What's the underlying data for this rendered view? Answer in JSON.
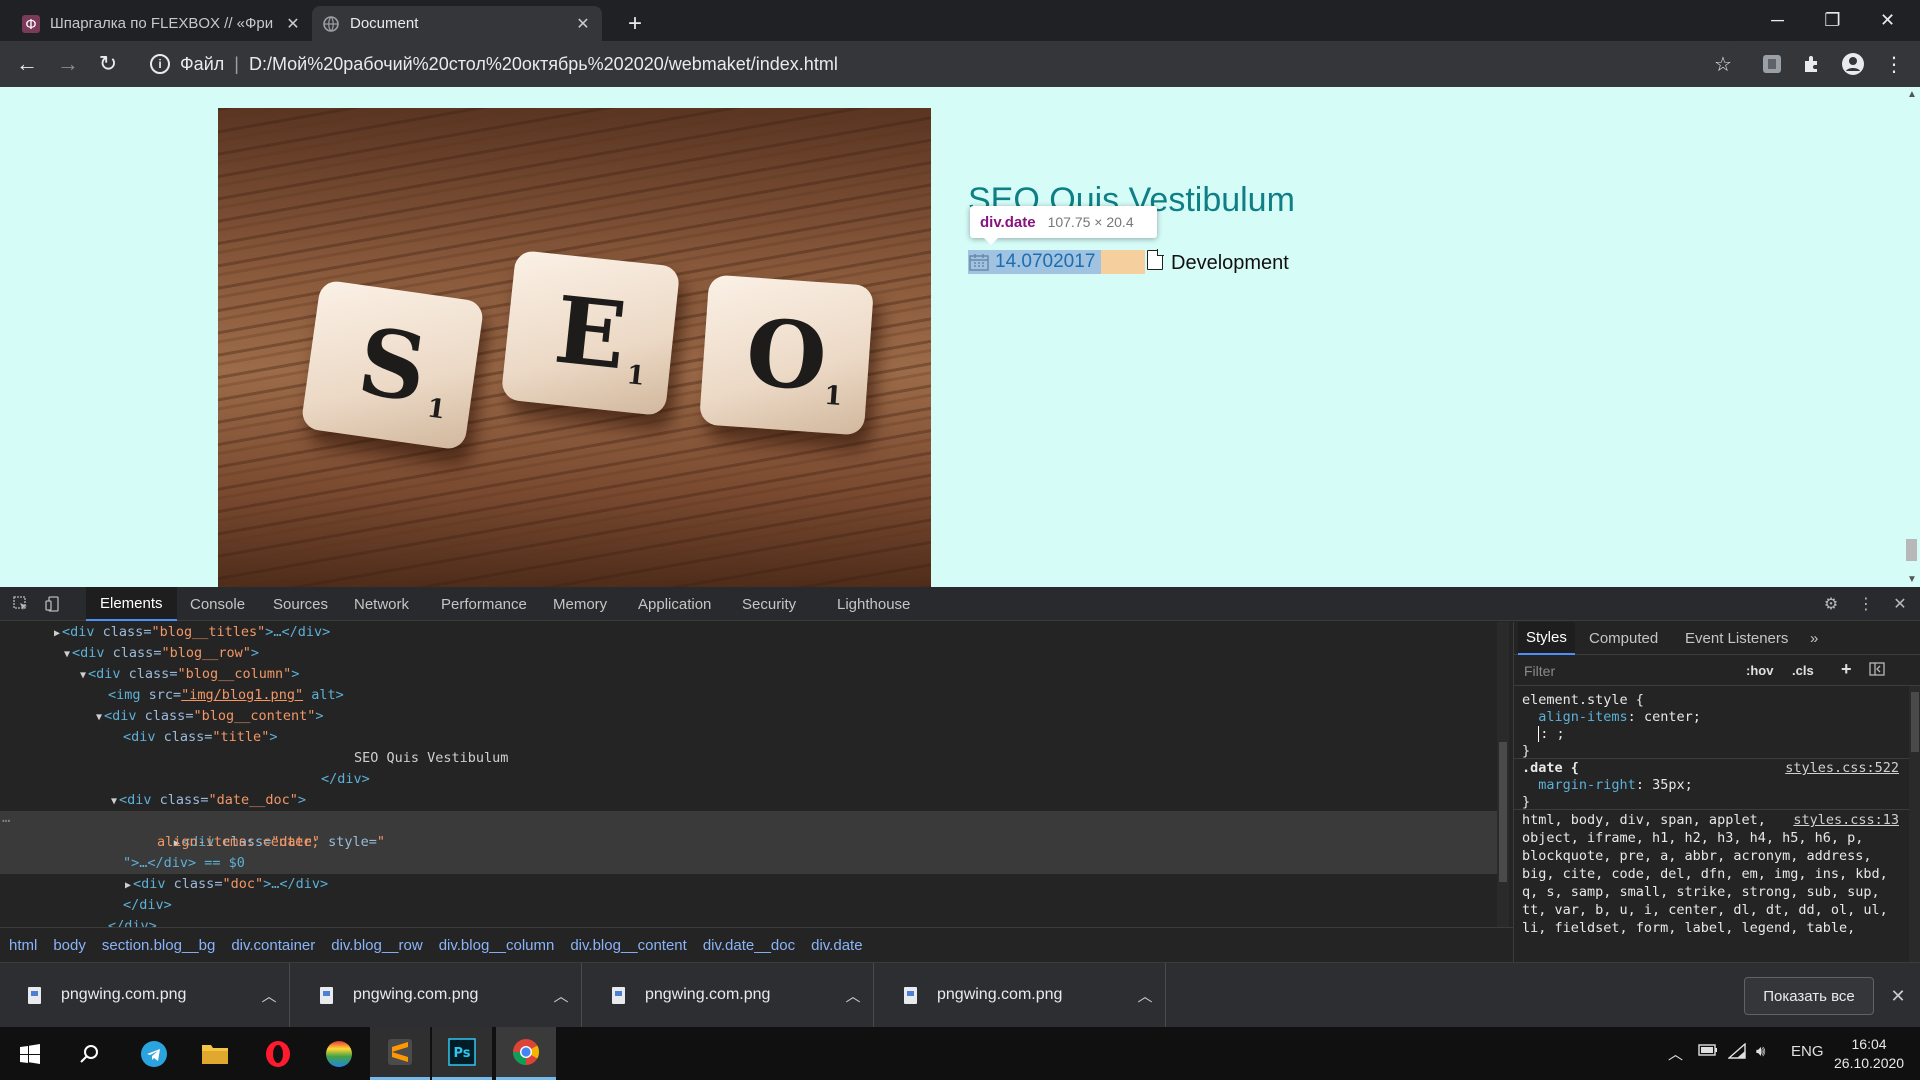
{
  "browser": {
    "tabs": [
      {
        "title": "Шпаргалка по FLEXBOX // «Фри",
        "active": false
      },
      {
        "title": "Document",
        "active": true
      }
    ],
    "address": {
      "scheme_label": "Файл",
      "url": "D:/Мой%20рабочий%20стол%20октябрь%202020/webmaket/index.html"
    }
  },
  "page": {
    "title": "SEO Quis Vestibulum",
    "tile_letters": [
      "S",
      "E",
      "O"
    ],
    "tile_subs": [
      "1",
      "1",
      "1"
    ],
    "date": "14.0702017",
    "doc": "Development",
    "inspect_tooltip": {
      "name": "div.date",
      "dims": "107.75 × 20.4"
    }
  },
  "devtools": {
    "tabs": [
      "Elements",
      "Console",
      "Sources",
      "Network",
      "Performance",
      "Memory",
      "Application",
      "Security",
      "Lighthouse"
    ],
    "active_tab": "Elements",
    "dom_lines": [
      {
        "arrow": "▶",
        "tag": "<div",
        "attr": " class=",
        "val": "\"blog__titles\"",
        "tail": ">…</div>"
      },
      {
        "arrow": "▼",
        "tag": "<div",
        "attr": " class=",
        "val": "\"blog__row\"",
        "tail": ">"
      },
      {
        "arrow": "▼",
        "tag": "<div",
        "attr": " class=",
        "val": "\"blog__column\"",
        "tail": ">"
      },
      {
        "arrow": "",
        "tag": "<img",
        "attr": " src=",
        "val": "\"img/blog1.png\"",
        "tail": " alt>"
      },
      {
        "arrow": "▼",
        "tag": "<div",
        "attr": " class=",
        "val": "\"blog__content\"",
        "tail": ">"
      },
      {
        "arrow": "",
        "tag": "<div",
        "attr": " class=",
        "val": "\"title\"",
        "tail": ">"
      },
      {
        "text": "SEO Quis Vestibulum"
      },
      {
        "close": "</div>"
      },
      {
        "arrow": "▼",
        "tag": "<div",
        "attr": " class=",
        "val": "\"date__doc\"",
        "tail": ">"
      },
      {
        "arrow": "▶",
        "tag": "<div",
        "attr": " class=",
        "val": "\"date\"",
        "attr2": " style=",
        "val2": "\"",
        "tail": ""
      },
      {
        "css": "align-items: center;"
      },
      {
        "close": "\">…</div> == $0"
      },
      {
        "arrow": "▶",
        "tag": "<div",
        "attr": " class=",
        "val": "\"doc\"",
        "tail": ">…</div>"
      },
      {
        "close": "</div>"
      },
      {
        "close": "</div>"
      }
    ],
    "breadcrumbs": [
      "html",
      "body",
      "section.blog__bg",
      "div.container",
      "div.blog__row",
      "div.blog__column",
      "div.blog__content",
      "div.date__doc",
      "div.date"
    ],
    "styles_tabs": [
      "Styles",
      "Computed",
      "Event Listeners",
      "»"
    ],
    "filter_placeholder": "Filter",
    "hov": ":hov",
    "cls": ".cls",
    "element_style": {
      "selector": "element.style {",
      "prop": "align-items",
      "value": "center;",
      "empty": ": ;",
      "close": "}"
    },
    "date_rule": {
      "selector": ".date {",
      "source": "styles.css:522",
      "prop": "margin-right",
      "value": "35px;",
      "close": "}"
    },
    "reset_rule": {
      "source": "styles.css:13",
      "lines": [
        "html, body, div, span, applet,",
        "object, iframe, h1, h2, h3, h4, h5, h6, p,",
        "blockquote, pre, a, abbr, acronym, address,",
        "big, cite, code, del, dfn, em, img, ins, kbd,",
        "q, s, samp, small, strike, strong, sub, sup,",
        "tt, var, b, u, i, center, dl, dt, dd, ol, ul,",
        "li, fieldset, form, label, legend, table,"
      ]
    }
  },
  "downloads": {
    "items": [
      "pngwing.com.png",
      "pngwing.com.png",
      "pngwing.com.png",
      "pngwing.com.png"
    ],
    "show_all": "Показать все"
  },
  "taskbar": {
    "lang": "ENG",
    "time": "16:04",
    "date": "26.10.2020"
  }
}
